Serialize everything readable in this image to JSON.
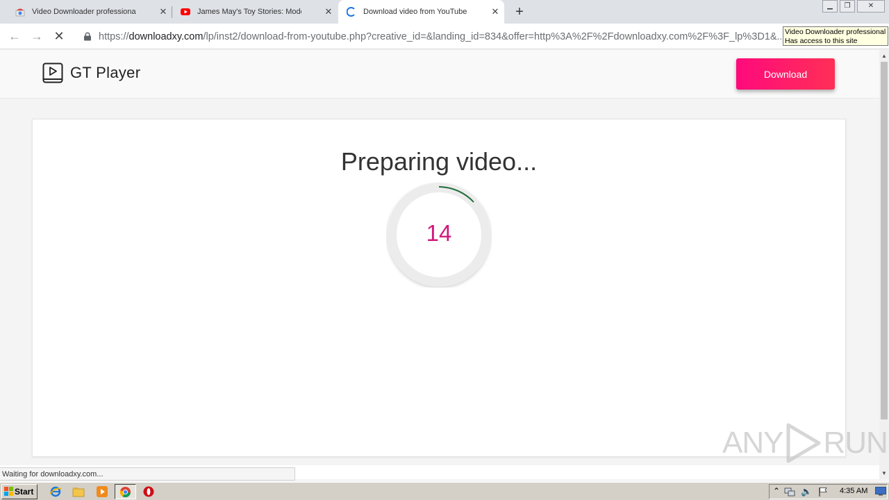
{
  "browser": {
    "tabs": [
      {
        "title": "Video Downloader professional - Chr",
        "icon": "chrome-webstore-icon",
        "active": false
      },
      {
        "title": "James May's Toy Stories: Model AIRF",
        "icon": "youtube-icon",
        "active": false
      },
      {
        "title": "Download video from YouTube with G",
        "icon": "loading-spinner-icon",
        "active": true
      }
    ],
    "new_tab": "+",
    "url": {
      "scheme": "https://",
      "host": "downloadxy.com",
      "path": "/lp/inst2/download-from-youtube.php?creative_id=&landing_id=834&offer=http%3A%2F%2Fdownloadxy.com%2F%3F_lp%3D1&..."
    },
    "tooltip": {
      "line1": "Video Downloader professional",
      "line2": "Has access to this site"
    },
    "status": "Waiting for downloadxy.com..."
  },
  "site": {
    "logo_text": "GT Player",
    "download_label": "Download",
    "title": "Preparing video...",
    "countdown": "14",
    "accent": "#d01a7c",
    "button_gradient": [
      "#ff0a7c",
      "#ff2f56"
    ],
    "spinner_color": "#1e6b3a"
  },
  "watermark": {
    "left": "ANY",
    "right": "RUN"
  },
  "taskbar": {
    "start_label": "Start",
    "clock": "4:35 AM"
  }
}
